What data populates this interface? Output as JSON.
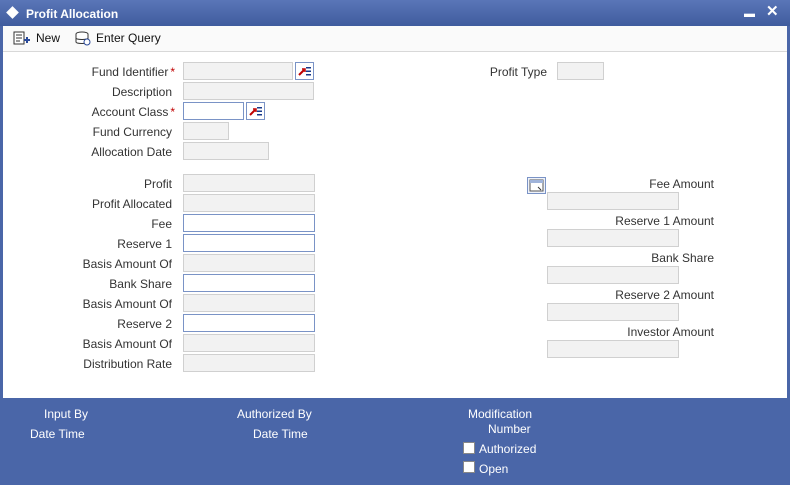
{
  "window": {
    "title": "Profit Allocation",
    "minimize_glyph": "▬",
    "close_glyph": "✕"
  },
  "toolbar": {
    "new_label": "New",
    "enter_query_label": "Enter Query"
  },
  "form": {
    "fund_identifier_label": "Fund Identifier",
    "description_label": "Description",
    "account_class_label": "Account Class",
    "fund_currency_label": "Fund Currency",
    "allocation_date_label": "Allocation Date",
    "profit_type_label": "Profit Type",
    "required_mark": "*",
    "profit_label": "Profit",
    "profit_allocated_label": "Profit Allocated",
    "fee_label": "Fee",
    "reserve1_label": "Reserve 1",
    "basis_amount_of_1_label": "Basis Amount Of",
    "bank_share_label": "Bank Share",
    "basis_amount_of_2_label": "Basis Amount Of",
    "reserve2_label": "Reserve 2",
    "basis_amount_of_3_label": "Basis Amount Of",
    "distribution_rate_label": "Distribution Rate",
    "fee_amount_label": "Fee Amount",
    "reserve1_amount_label": "Reserve 1 Amount",
    "bank_share_right_label": "Bank Share",
    "reserve2_amount_label": "Reserve 2 Amount",
    "investor_amount_label": "Investor Amount"
  },
  "footer": {
    "input_by_label": "Input By",
    "date_time_label_1": "Date Time",
    "authorized_by_label": "Authorized By",
    "date_time_label_2": "Date Time",
    "modification_label": "Modification",
    "number_label": "Number",
    "authorized_checkbox_label": "Authorized",
    "open_checkbox_label": "Open"
  },
  "colors": {
    "frame": "#4a66a8",
    "required": "#c00000",
    "editable_border": "#7a93c6"
  },
  "icons": {
    "new": "new-record-icon",
    "enter_query": "database-query-icon",
    "lov": "list-of-values-icon",
    "calculate": "calculate-icon"
  }
}
